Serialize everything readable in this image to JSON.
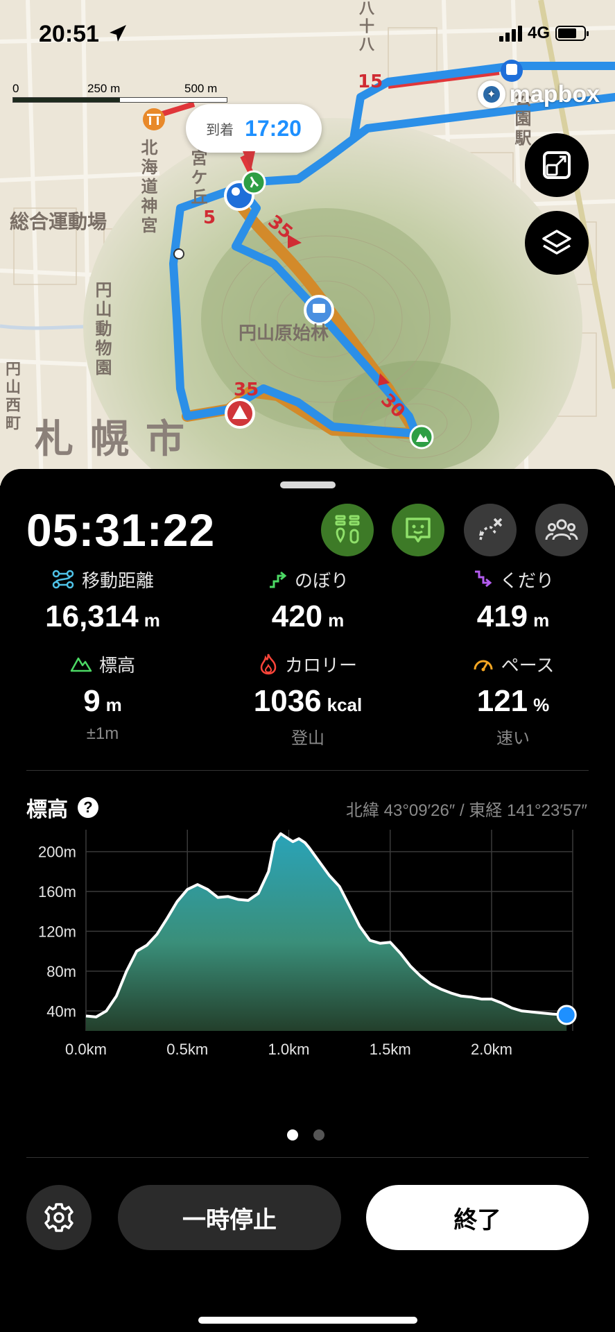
{
  "status_bar": {
    "time": "20:51",
    "network": "4G",
    "battery_level": 0.72
  },
  "map": {
    "scale_labels": [
      "0",
      "250 m",
      "500 m"
    ],
    "attribution": "mapbox",
    "eta": {
      "label": "到着",
      "time": "17:20"
    },
    "labels": {
      "kitakaido": "北海道神宮",
      "miyagaoka": "宮ケ丘",
      "sogo": "総合運動場",
      "maruyama_zoo": "円山動物園",
      "maruyama_forest": "円山原始林",
      "sapporo": "札幌市",
      "nishi": "円山西町",
      "hachijuhachi": "八十八",
      "park": "公園駅"
    },
    "route_markers": [
      "15",
      "5",
      "35",
      "35",
      "30"
    ],
    "colors": {
      "route": "#2b8fe8",
      "warning": "#e0363a",
      "route_edge": "#d38a2a"
    }
  },
  "panel": {
    "elapsed_time": "05:31:22",
    "stats": [
      {
        "key": "distance",
        "label": "移動距離",
        "value": "16,314",
        "unit": "m",
        "sub": ""
      },
      {
        "key": "ascent",
        "label": "のぼり",
        "value": "420",
        "unit": "m",
        "sub": ""
      },
      {
        "key": "descent",
        "label": "くだり",
        "value": "419",
        "unit": "m",
        "sub": ""
      },
      {
        "key": "elevation",
        "label": "標高",
        "value": "9",
        "unit": "m",
        "sub": "±1m"
      },
      {
        "key": "calories",
        "label": "カロリー",
        "value": "1036",
        "unit": "kcal",
        "sub": "登山"
      },
      {
        "key": "pace",
        "label": "ペース",
        "value": "121",
        "unit": "%",
        "sub": "速い"
      }
    ],
    "elevation_title": "標高",
    "coordinates": "北緯 43°09′26″ / 東経 141°23′57″",
    "page_count": 2,
    "active_page": 0,
    "pause_label": "一時停止",
    "end_label": "終了"
  },
  "chart_data": {
    "type": "area",
    "xlabel": "",
    "ylabel": "",
    "x_ticks": [
      "0.0km",
      "0.5km",
      "1.0km",
      "1.5km",
      "2.0km"
    ],
    "y_ticks": [
      "40m",
      "80m",
      "120m",
      "160m",
      "200m"
    ],
    "xlim": [
      0,
      2.4
    ],
    "ylim": [
      20,
      222
    ],
    "x": [
      0.0,
      0.05,
      0.1,
      0.15,
      0.2,
      0.25,
      0.3,
      0.35,
      0.4,
      0.45,
      0.5,
      0.55,
      0.6,
      0.65,
      0.7,
      0.75,
      0.8,
      0.85,
      0.9,
      0.93,
      0.96,
      0.99,
      1.02,
      1.05,
      1.08,
      1.1,
      1.15,
      1.2,
      1.25,
      1.3,
      1.35,
      1.4,
      1.45,
      1.5,
      1.55,
      1.6,
      1.65,
      1.7,
      1.75,
      1.8,
      1.85,
      1.9,
      1.95,
      2.0,
      2.05,
      2.1,
      2.15,
      2.2,
      2.25,
      2.3,
      2.37
    ],
    "values": [
      35,
      34,
      40,
      55,
      80,
      100,
      106,
      117,
      133,
      150,
      162,
      167,
      162,
      154,
      155,
      152,
      151,
      158,
      180,
      210,
      218,
      214,
      210,
      213,
      209,
      204,
      190,
      176,
      165,
      145,
      125,
      111,
      108,
      109,
      98,
      85,
      75,
      67,
      62,
      58,
      55,
      54,
      52,
      52,
      48,
      43,
      40,
      39,
      38,
      37,
      36
    ],
    "grid": true,
    "fill_color": "#3a8f8a",
    "line_color": "#ffffff",
    "end_marker_color": "#1e90ff"
  }
}
